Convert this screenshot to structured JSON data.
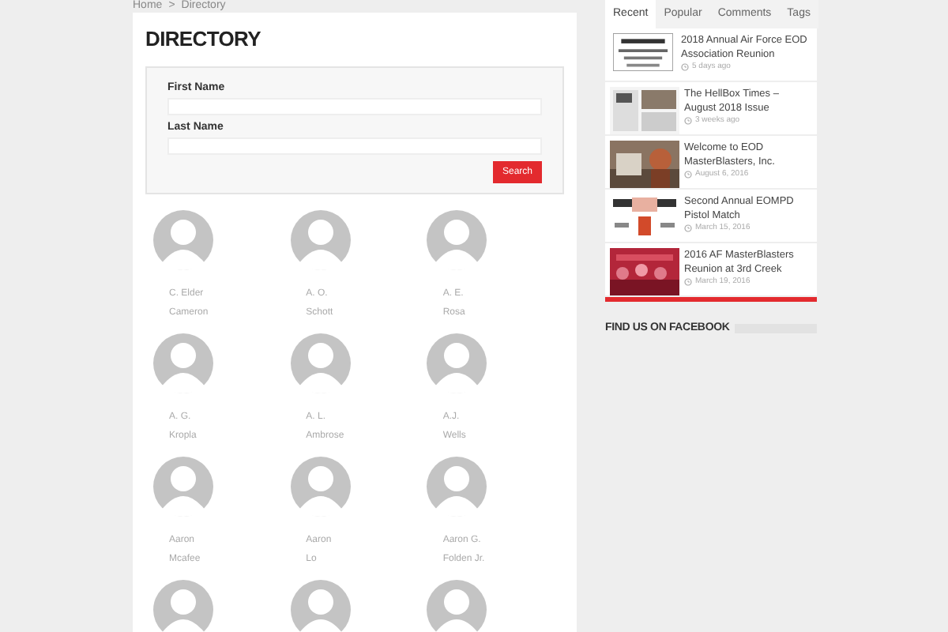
{
  "breadcrumb": {
    "items": [
      "Home",
      "Directory"
    ],
    "separator": ">"
  },
  "directory": {
    "title": "DIRECTORY",
    "fields": [
      {
        "label": "First Name"
      },
      {
        "label": "Last Name"
      }
    ],
    "button": "Search",
    "people": [
      {
        "first": "C. Elder",
        "last": "Cameron"
      },
      {
        "first": "A. O.",
        "last": "Schott"
      },
      {
        "first": "A. E.",
        "last": "Rosa"
      },
      {
        "first": "A. G.",
        "last": "Kropla"
      },
      {
        "first": "A. L.",
        "last": "Ambrose"
      },
      {
        "first": "A.J.",
        "last": "Wells"
      },
      {
        "first": "Aaron",
        "last": "Mcafee"
      },
      {
        "first": "Aaron",
        "last": "Lo"
      },
      {
        "first": "Aaron G.",
        "last": "Folden Jr."
      }
    ]
  },
  "sidebar": {
    "tabs": [
      {
        "label": "Recent",
        "selected": true
      },
      {
        "label": "Popular",
        "selected": false
      },
      {
        "label": "Comments",
        "selected": false
      },
      {
        "label": "Tags",
        "selected": false
      }
    ],
    "posts": [
      {
        "title": "2018 Annual Air Force EOD Association Reunion",
        "date": "5 days ago"
      },
      {
        "title": "The HellBox Times – August 2018 Issue",
        "date": "3 weeks ago"
      },
      {
        "title": "Welcome to EOD MasterBlasters, Inc.",
        "date": "August 6, 2016"
      },
      {
        "title": "Second Annual EOMPD Pistol Match",
        "date": "March 15, 2016"
      },
      {
        "title": "2016 AF MasterBlasters Reunion at 3rd Creek",
        "date": "March 19, 2016"
      }
    ],
    "facebook_heading": "FIND US ON FACEBOOK"
  }
}
